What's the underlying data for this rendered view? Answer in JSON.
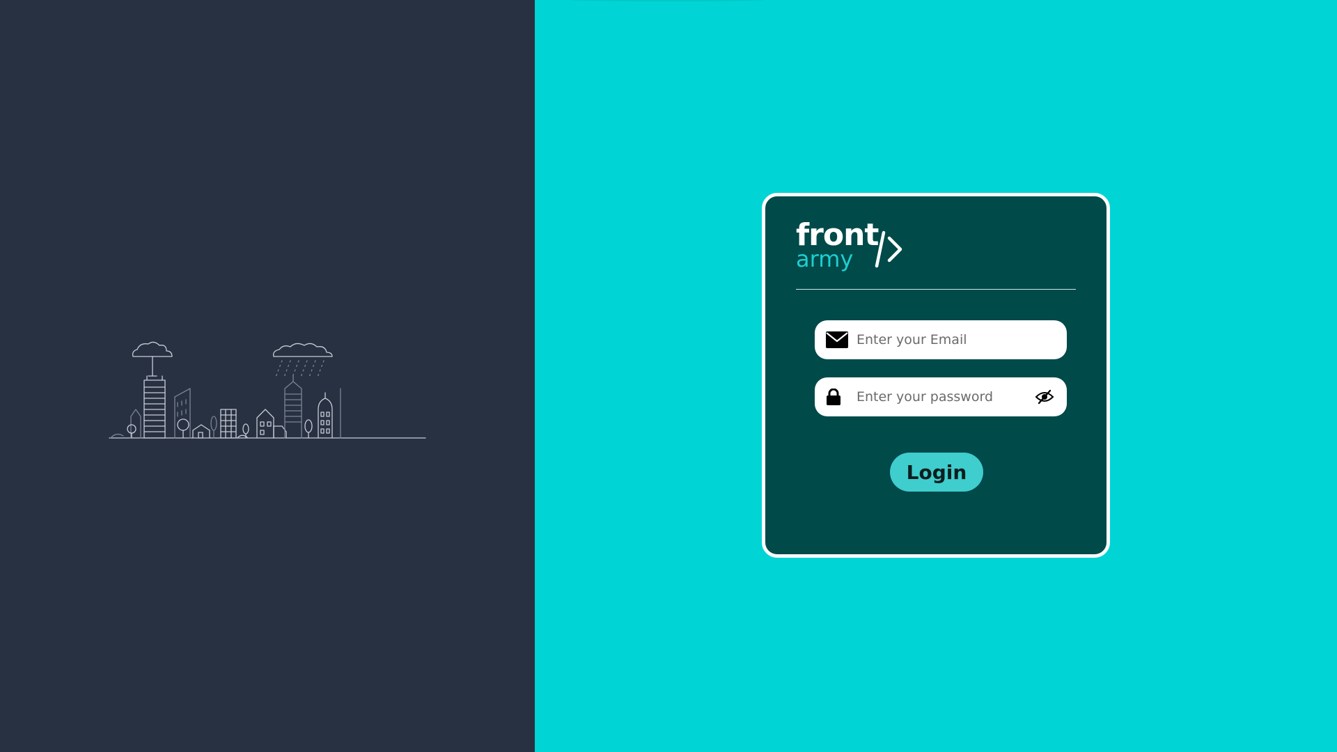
{
  "brand": {
    "word_top": "front",
    "word_bottom": "army",
    "mark_icon": "code-slash-chevron-icon"
  },
  "login_form": {
    "email": {
      "placeholder": "Enter your Email",
      "value": "",
      "icon": "envelope-icon"
    },
    "password": {
      "placeholder": "Enter your password",
      "value": "",
      "icon": "lock-icon",
      "toggle_icon": "eye-slash-icon"
    },
    "submit_label": "Login"
  },
  "illustration": {
    "icon": "city-skyline-icon"
  },
  "colors": {
    "left_background": "#283142",
    "right_background": "#00d4d4",
    "card_background": "#004a4a",
    "card_border": "#ffffff",
    "brand_accent": "#1ccfcf",
    "button_background": "#3fcdcd"
  }
}
